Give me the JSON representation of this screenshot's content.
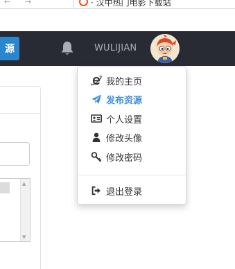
{
  "browser": {
    "back_glyph": "←",
    "forward_glyph": "→",
    "tab_title": "· 汉中热门电影下载站"
  },
  "navbar": {
    "publish_label": "源",
    "username": "WULIJIAN",
    "bell_icon": "bell-icon",
    "avatar_icon": "avatar-icon"
  },
  "user_menu": {
    "items": [
      {
        "label": "我的主页",
        "icon": "ie-icon"
      },
      {
        "label": "发布资源",
        "icon": "send-icon",
        "active": true
      },
      {
        "label": "个人设置",
        "icon": "id-card-icon"
      },
      {
        "label": "修改头像",
        "icon": "user-icon"
      },
      {
        "label": "修改密码",
        "icon": "key-icon"
      },
      {
        "label": "退出登录",
        "icon": "sign-out-icon"
      }
    ]
  },
  "colors": {
    "navbar_bg": "#282b33",
    "accent": "#2a86cf",
    "active_menu_text": "#3d8fd8"
  }
}
